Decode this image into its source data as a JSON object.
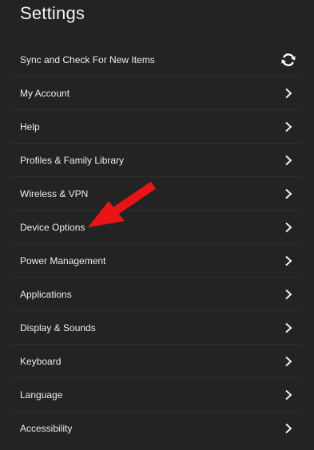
{
  "header": {
    "title": "Settings"
  },
  "items": [
    {
      "label": "Sync and Check For New Items",
      "icon": "sync-icon"
    },
    {
      "label": "My Account",
      "icon": "chevron-right-icon"
    },
    {
      "label": "Help",
      "icon": "chevron-right-icon"
    },
    {
      "label": "Profiles & Family Library",
      "icon": "chevron-right-icon"
    },
    {
      "label": "Wireless & VPN",
      "icon": "chevron-right-icon"
    },
    {
      "label": "Device Options",
      "icon": "chevron-right-icon"
    },
    {
      "label": "Power Management",
      "icon": "chevron-right-icon"
    },
    {
      "label": "Applications",
      "icon": "chevron-right-icon"
    },
    {
      "label": "Display & Sounds",
      "icon": "chevron-right-icon"
    },
    {
      "label": "Keyboard",
      "icon": "chevron-right-icon"
    },
    {
      "label": "Language",
      "icon": "chevron-right-icon"
    },
    {
      "label": "Accessibility",
      "icon": "chevron-right-icon"
    }
  ],
  "annotation": {
    "icon": "red-arrow-icon",
    "color": "#e81416"
  },
  "colors": {
    "background": "#232323",
    "text": "#ececec",
    "divider": "#2f2f2f"
  }
}
